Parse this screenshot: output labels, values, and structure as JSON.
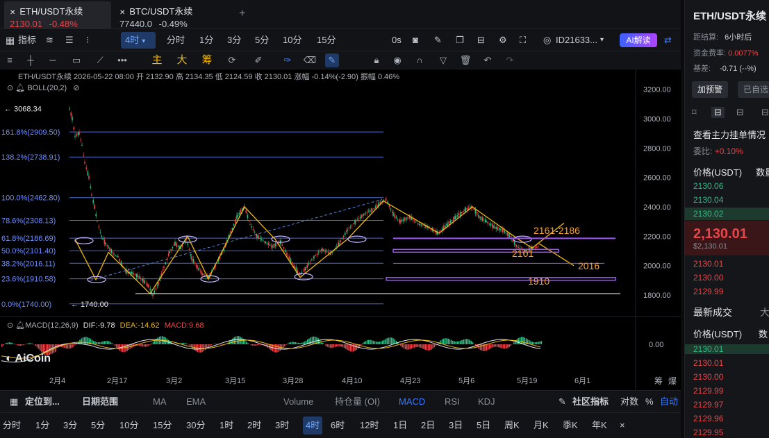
{
  "tabs": [
    {
      "symbol": "ETH/USDT永续",
      "price": "2130.01",
      "change": "-0.48%",
      "color": "#e8464a"
    },
    {
      "symbol": "BTC/USDT永续",
      "price": "77440.0",
      "change": "-0.49%",
      "color": "#c9ccd3"
    }
  ],
  "new_tab": "+",
  "toolbar": {
    "indicators": "指标",
    "interval": "4时",
    "tf": [
      "分时",
      "1分",
      "3分",
      "5分",
      "10分",
      "15分"
    ],
    "seconds": "0s",
    "account": "ID21633...",
    "ai": "AI解读"
  },
  "drawbar": {
    "main": "主",
    "big": "大",
    "chip": "筹"
  },
  "info": {
    "line": "ETH/USDT永续  2026-05-22 08:00  开 2132.90  高 2134.35  低 2124.59  收 2130.01  涨幅 -0.14%(-2.90)  振幅 0.46%",
    "boll": "BOLL(20,2)"
  },
  "chart_data": {
    "type": "candlestick",
    "symbol": "ETH/USDT永续",
    "interval": "4h",
    "high_label": "3068.34",
    "low_label": "1740.00",
    "ylim": [
      1740,
      3250
    ],
    "yticks": [
      "3200.00",
      "3000.00",
      "2800.00",
      "2600.00",
      "2400.00",
      "2200.00",
      "2000.00",
      "1800.00"
    ],
    "xticks": [
      "2月4",
      "2月17",
      "3月2",
      "3月15",
      "3月28",
      "4月10",
      "4月23",
      "5月6",
      "5月19",
      "6月1"
    ],
    "fib_levels": [
      {
        "label": "161.8%(2909.50)",
        "price": 2909.5
      },
      {
        "label": "138.2%(2738.91)",
        "price": 2738.91
      },
      {
        "label": "100.0%(2462.80)",
        "price": 2462.8
      },
      {
        "label": "78.6%(2308.13)",
        "price": 2308.13
      },
      {
        "label": "61.8%(2186.69)",
        "price": 2186.69
      },
      {
        "label": "50.0%(2101.40)",
        "price": 2101.4
      },
      {
        "label": "38.2%(2016.11)",
        "price": 2016.11
      },
      {
        "label": "23.6%(1910.58)",
        "price": 1910.58
      },
      {
        "label": "0.0%(1740.00)",
        "price": 1740
      }
    ],
    "annotations": [
      "2161-2186",
      "2101",
      "2016",
      "1910"
    ],
    "macd": {
      "label": "MACD(12,26,9)",
      "dif": "DIF:-9.78",
      "dea": "DEA:-14.62",
      "macd": "MACD:9.68",
      "zero": "0.00"
    }
  },
  "bottom1": {
    "goto": "定位到...",
    "range": "日期范围",
    "items": [
      "MA",
      "EMA",
      "Volume",
      "持仓量 (OI)",
      "MACD",
      "RSI",
      "KDJ"
    ],
    "community": "社区指标",
    "log": "对数",
    "pct": "%",
    "auto": "自动"
  },
  "bottom2": [
    "分时",
    "1分",
    "3分",
    "5分",
    "10分",
    "15分",
    "30分",
    "1时",
    "2时",
    "3时",
    "4时",
    "6时",
    "12时",
    "1日",
    "2日",
    "3日",
    "5日",
    "周K",
    "月K",
    "季K",
    "年K"
  ],
  "right": {
    "title": "ETH/USDT永续",
    "settle_label": "距结算:",
    "settle_val": "6小时后",
    "funding_label": "资金费率:",
    "funding_val": "0.0077%",
    "basis_label": "基差:",
    "basis_val": "-0.71 (--%)",
    "alert_btn": "加预警",
    "added_btn": "已自选",
    "depth_title": "查看主力挂单情况",
    "ratio_label": "委比:",
    "ratio_val": "+0.10%",
    "price_header": "价格(USDT)",
    "qty_header": "数量",
    "asks": [
      "2130.06",
      "2130.04",
      "2130.02"
    ],
    "last": "2,130.01",
    "last_sub": "$2,130.01",
    "bids": [
      "2130.01",
      "2130.00",
      "2129.99"
    ],
    "trades_title": "最新成交",
    "trades_tab2": "大",
    "trades_header": "价格(USDT)",
    "trades_qty": "数",
    "trades": [
      {
        "p": "2130.01",
        "c": "green"
      },
      {
        "p": "2130.01",
        "c": "red"
      },
      {
        "p": "2130.00",
        "c": "red"
      },
      {
        "p": "2129.99",
        "c": "red"
      },
      {
        "p": "2129.97",
        "c": "red"
      },
      {
        "p": "2129.96",
        "c": "red"
      },
      {
        "p": "2129.95",
        "c": "red"
      }
    ]
  },
  "logo": "AiCoin",
  "corner": [
    "筹",
    "爆"
  ]
}
